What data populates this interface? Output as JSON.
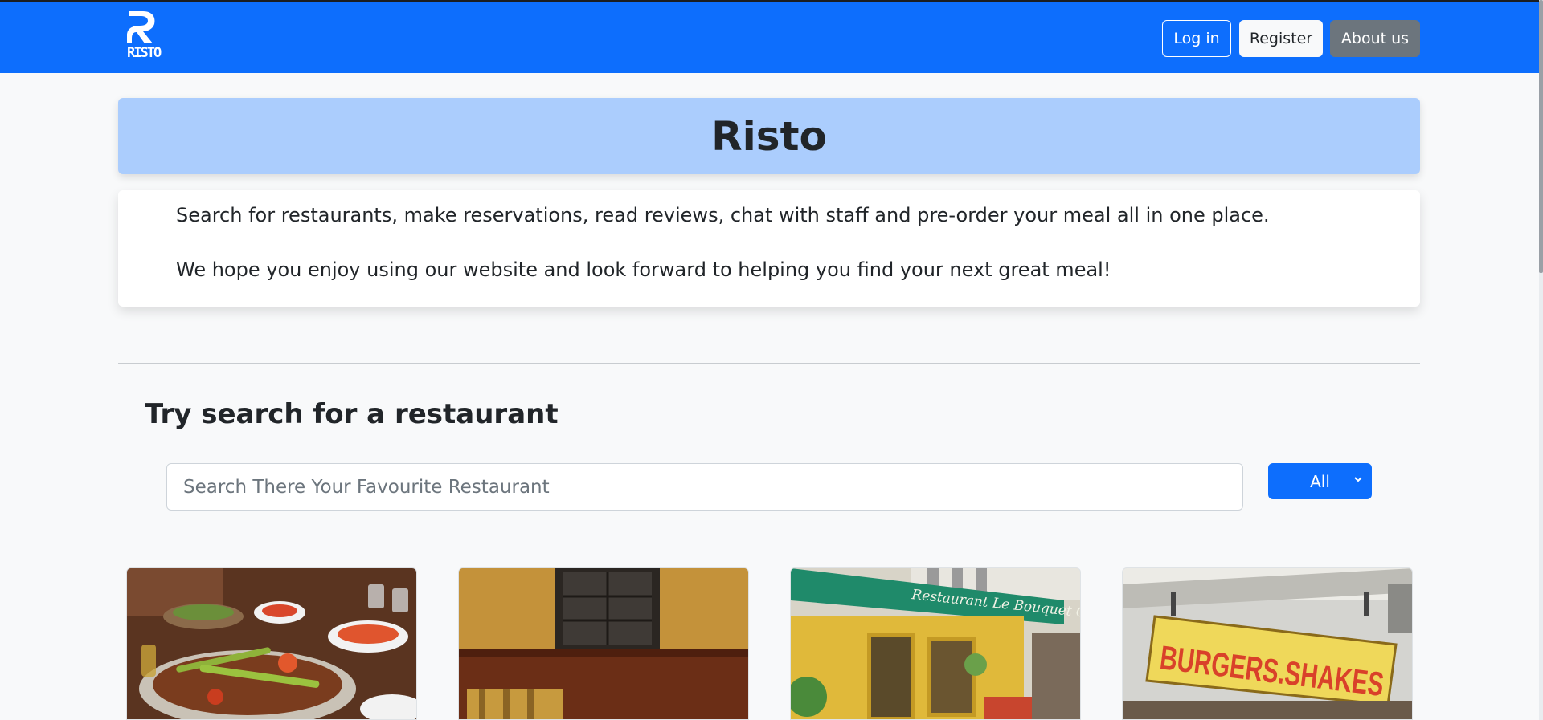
{
  "navbar": {
    "logo_text": "RISTO",
    "login_label": "Log in",
    "register_label": "Register",
    "about_label": "About us"
  },
  "banner": {
    "title": "Risto"
  },
  "intro": {
    "line1": "Search for restaurants, make reservations, read reviews, chat with staff and pre-order your meal all in one place.",
    "line2": "We hope you enjoy using our website and look forward to helping you find your next great meal!"
  },
  "search": {
    "heading": "Try search for a restaurant",
    "placeholder": "Search There Your Favourite Restaurant",
    "value": "",
    "filter_selected": "All"
  },
  "restaurants": [
    {
      "image": "grilled-kebab-platter-photo",
      "sign_text": ""
    },
    {
      "image": "restaurant-interior-photo",
      "sign_text": ""
    },
    {
      "image": "restaurant-storefront-photo",
      "sign_text": "Restaurant Le Bouquet Garni"
    },
    {
      "image": "burger-shop-sign-photo",
      "sign_text": "BURGERS.SHAKES"
    }
  ],
  "colors": {
    "primary": "#0d6efd",
    "banner": "#abcdfd",
    "secondary": "#6c757d",
    "background": "#f8f9fa"
  }
}
